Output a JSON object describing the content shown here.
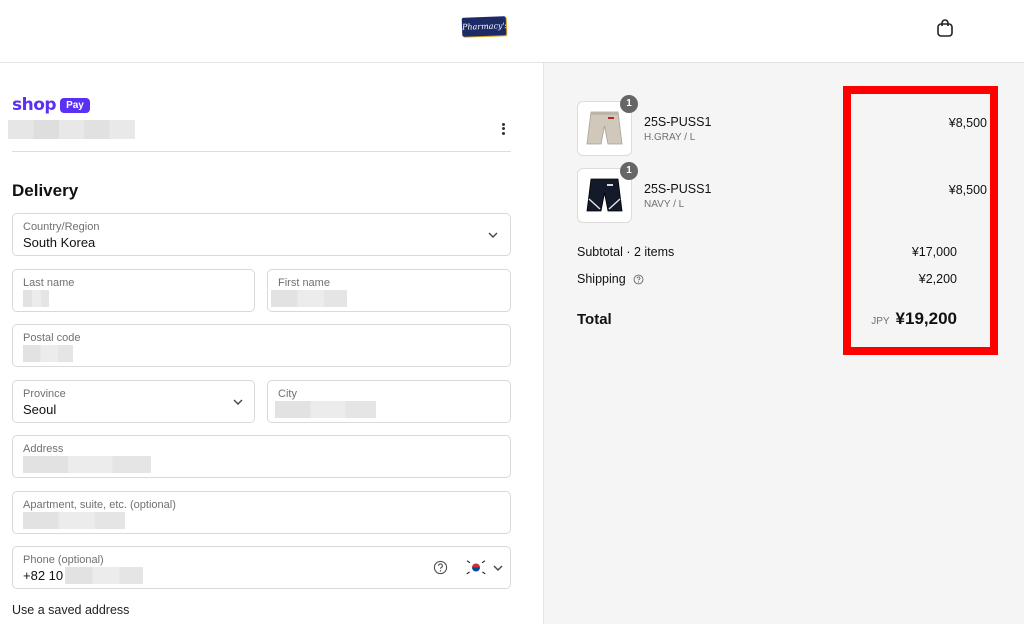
{
  "header": {
    "logo_text": "Pharmacy's",
    "cart_icon": "shopping-bag-icon"
  },
  "shop_pay": {
    "shop": "shop",
    "pay": "Pay"
  },
  "delivery": {
    "title": "Delivery",
    "country": {
      "label": "Country/Region",
      "value": "South Korea"
    },
    "last_name": {
      "label": "Last name"
    },
    "first_name": {
      "label": "First name"
    },
    "postal_code": {
      "label": "Postal code"
    },
    "province": {
      "label": "Province",
      "value": "Seoul"
    },
    "city": {
      "label": "City"
    },
    "address": {
      "label": "Address"
    },
    "apartment": {
      "label": "Apartment, suite, etc. (optional)"
    },
    "phone": {
      "label": "Phone (optional)",
      "value": "+82 10"
    },
    "saved_address_link": "Use a saved address"
  },
  "order": {
    "items": [
      {
        "quantity": "1",
        "name": "25S-PUSS1",
        "variant": "H.GRAY / L",
        "price": "¥8,500",
        "color": "#cfc8bb"
      },
      {
        "quantity": "1",
        "name": "25S-PUSS1",
        "variant": "NAVY / L",
        "price": "¥8,500",
        "color": "#141a2a"
      }
    ],
    "subtotal_label": "Subtotal · 2 items",
    "subtotal_value": "¥17,000",
    "shipping_label": "Shipping",
    "shipping_value": "¥2,200",
    "total_label": "Total",
    "total_currency": "JPY",
    "total_value": "¥19,200"
  },
  "colors": {
    "shop_pay_purple": "#5a31f4",
    "highlight_red": "#ff0000"
  }
}
